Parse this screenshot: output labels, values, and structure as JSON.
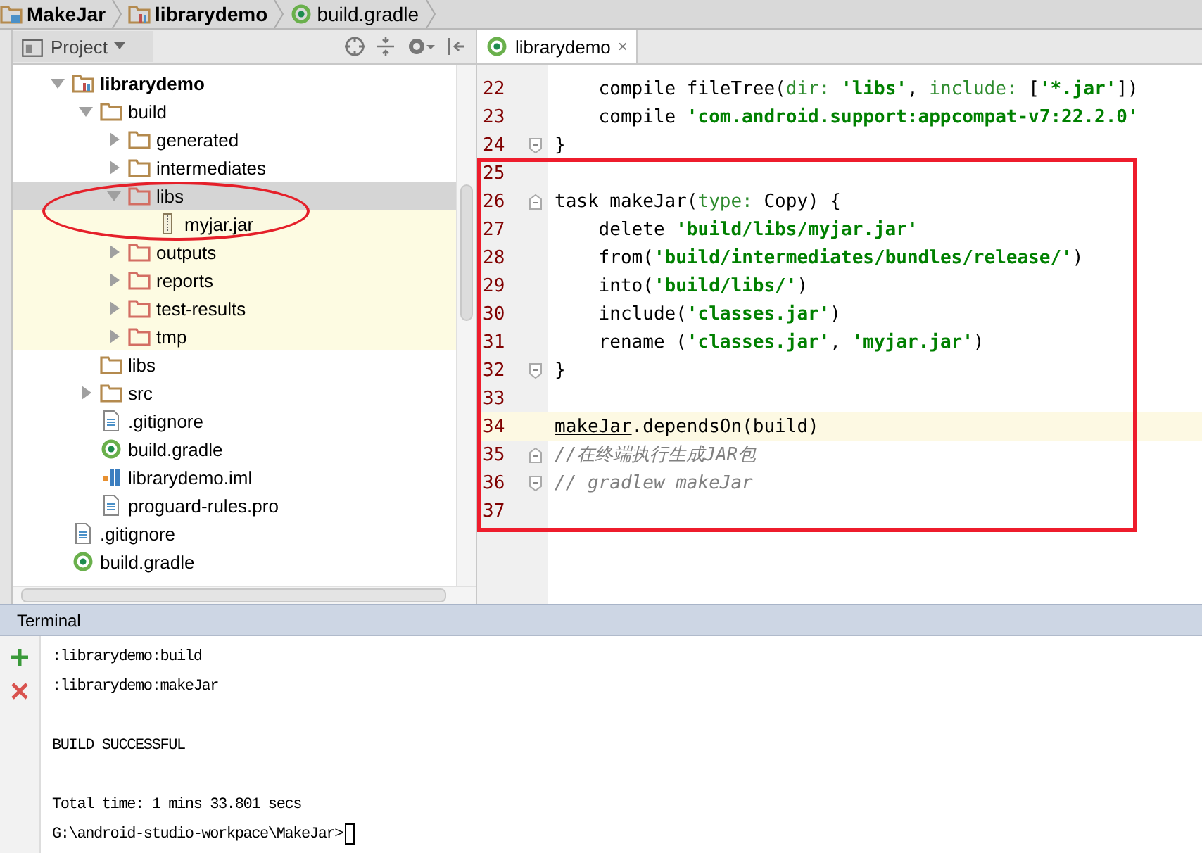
{
  "breadcrumbs": [
    {
      "label": "MakeJar",
      "kind": "project"
    },
    {
      "label": "librarydemo",
      "kind": "module"
    },
    {
      "label": "build.gradle",
      "kind": "gradle"
    }
  ],
  "project_panel": {
    "view_selector": "Project",
    "tree": [
      {
        "label": "librarydemo",
        "kind": "module",
        "expandable": true,
        "expanded": true,
        "selected": false,
        "highlighted": false,
        "children": [
          {
            "label": "build",
            "kind": "folder",
            "expandable": true,
            "expanded": true,
            "selected": false,
            "highlighted": false,
            "children": [
              {
                "label": "generated",
                "kind": "folder",
                "expandable": true,
                "expanded": false,
                "selected": false,
                "highlighted": false
              },
              {
                "label": "intermediates",
                "kind": "folder",
                "expandable": true,
                "expanded": false,
                "selected": false,
                "highlighted": false
              },
              {
                "label": "libs",
                "kind": "excluded-folder",
                "expandable": true,
                "expanded": true,
                "selected": true,
                "highlighted": false,
                "children": [
                  {
                    "label": "myjar.jar",
                    "kind": "jar",
                    "expandable": false,
                    "selected": false,
                    "highlighted": true
                  }
                ]
              },
              {
                "label": "outputs",
                "kind": "excluded-folder",
                "expandable": true,
                "expanded": false,
                "selected": false,
                "highlighted": true
              },
              {
                "label": "reports",
                "kind": "excluded-folder",
                "expandable": true,
                "expanded": false,
                "selected": false,
                "highlighted": true
              },
              {
                "label": "test-results",
                "kind": "excluded-folder",
                "expandable": true,
                "expanded": false,
                "selected": false,
                "highlighted": true
              },
              {
                "label": "tmp",
                "kind": "excluded-folder",
                "expandable": true,
                "expanded": false,
                "selected": false,
                "highlighted": true
              }
            ]
          },
          {
            "label": "libs",
            "kind": "folder",
            "expandable": false,
            "selected": false,
            "highlighted": false
          },
          {
            "label": "src",
            "kind": "folder",
            "expandable": true,
            "expanded": false,
            "selected": false,
            "highlighted": false
          },
          {
            "label": ".gitignore",
            "kind": "file",
            "expandable": false,
            "selected": false,
            "highlighted": false
          },
          {
            "label": "build.gradle",
            "kind": "gradle",
            "expandable": false,
            "selected": false,
            "highlighted": false
          },
          {
            "label": "librarydemo.iml",
            "kind": "iml",
            "expandable": false,
            "selected": false,
            "highlighted": false
          },
          {
            "label": "proguard-rules.pro",
            "kind": "file",
            "expandable": false,
            "selected": false,
            "highlighted": false
          }
        ]
      },
      {
        "label": ".gitignore",
        "kind": "file",
        "expandable": false,
        "selected": false,
        "highlighted": false
      },
      {
        "label": "build.gradle",
        "kind": "gradle",
        "expandable": false,
        "selected": false,
        "highlighted": false
      }
    ]
  },
  "editor": {
    "tabs": [
      {
        "label": "librarydemo",
        "close": "×",
        "selected": true
      }
    ],
    "lines": [
      {
        "number": "22",
        "folding": false,
        "current": false,
        "segments": [
          {
            "kind": "text",
            "text": "    compile fileTree("
          },
          {
            "kind": "named",
            "text": "dir: "
          },
          {
            "kind": "string",
            "text": "'libs'"
          },
          {
            "kind": "text",
            "text": ", "
          },
          {
            "kind": "named",
            "text": "include:"
          },
          {
            "kind": "text",
            "text": " ["
          },
          {
            "kind": "string",
            "text": "'*.jar'"
          },
          {
            "kind": "text",
            "text": "])"
          }
        ]
      },
      {
        "number": "23",
        "folding": false,
        "current": false,
        "segments": [
          {
            "kind": "text",
            "text": "    compile "
          },
          {
            "kind": "string",
            "text": "'com.android.support:appcompat-v7:22.2.0'"
          }
        ]
      },
      {
        "number": "24",
        "folding": true,
        "fold_start": false,
        "current": false,
        "segments": [
          {
            "kind": "text",
            "text": "}"
          }
        ]
      },
      {
        "number": "25",
        "folding": false,
        "current": false
      },
      {
        "number": "26",
        "folding": true,
        "fold_start": true,
        "current": false,
        "segments": [
          {
            "kind": "text",
            "text": "task makeJar("
          },
          {
            "kind": "named",
            "text": "type:"
          },
          {
            "kind": "text",
            "text": " Copy) {"
          }
        ]
      },
      {
        "number": "27",
        "folding": false,
        "current": false,
        "segments": [
          {
            "kind": "text",
            "text": "    delete "
          },
          {
            "kind": "string",
            "text": "'build/libs/myjar.jar'"
          }
        ]
      },
      {
        "number": "28",
        "folding": false,
        "current": false,
        "segments": [
          {
            "kind": "text",
            "text": "    from("
          },
          {
            "kind": "string",
            "text": "'build/intermediates/bundles/release/'"
          },
          {
            "kind": "text",
            "text": ")"
          }
        ]
      },
      {
        "number": "29",
        "folding": false,
        "current": false,
        "segments": [
          {
            "kind": "text",
            "text": "    into("
          },
          {
            "kind": "string",
            "text": "'build/libs/'"
          },
          {
            "kind": "text",
            "text": ")"
          }
        ]
      },
      {
        "number": "30",
        "folding": false,
        "current": false,
        "segments": [
          {
            "kind": "text",
            "text": "    include("
          },
          {
            "kind": "string",
            "text": "'classes.jar'"
          },
          {
            "kind": "text",
            "text": ")"
          }
        ]
      },
      {
        "number": "31",
        "folding": false,
        "current": false,
        "segments": [
          {
            "kind": "text",
            "text": "    rename ("
          },
          {
            "kind": "string",
            "text": "'classes.jar'"
          },
          {
            "kind": "text",
            "text": ", "
          },
          {
            "kind": "string",
            "text": "'myjar.jar'"
          },
          {
            "kind": "text",
            "text": ")"
          }
        ]
      },
      {
        "number": "32",
        "folding": true,
        "fold_start": false,
        "current": false,
        "segments": [
          {
            "kind": "text",
            "text": "}"
          }
        ]
      },
      {
        "number": "33",
        "folding": false,
        "current": false
      },
      {
        "number": "34",
        "folding": false,
        "current": true,
        "segments": [
          {
            "kind": "ref",
            "text": "makeJar"
          },
          {
            "kind": "text",
            "text": ".dependsOn(build)"
          }
        ]
      },
      {
        "number": "35",
        "folding": true,
        "fold_start": true,
        "current": false,
        "segments": [
          {
            "kind": "comment",
            "text": "//在终端执行生成JAR包"
          }
        ]
      },
      {
        "number": "36",
        "folding": true,
        "fold_start": false,
        "current": false,
        "segments": [
          {
            "kind": "comment",
            "text": "// gradlew makeJar"
          }
        ]
      },
      {
        "number": "37",
        "folding": false,
        "current": false
      }
    ]
  },
  "terminal": {
    "title": "Terminal",
    "blocks": [
      [
        ":librarydemo:build",
        ":librarydemo:makeJar"
      ],
      [
        "BUILD SUCCESSFUL"
      ],
      [
        "Total time: 1 mins 33.801 secs"
      ]
    ],
    "prompt": "G:\\android-studio-workpace\\MakeJar>"
  }
}
